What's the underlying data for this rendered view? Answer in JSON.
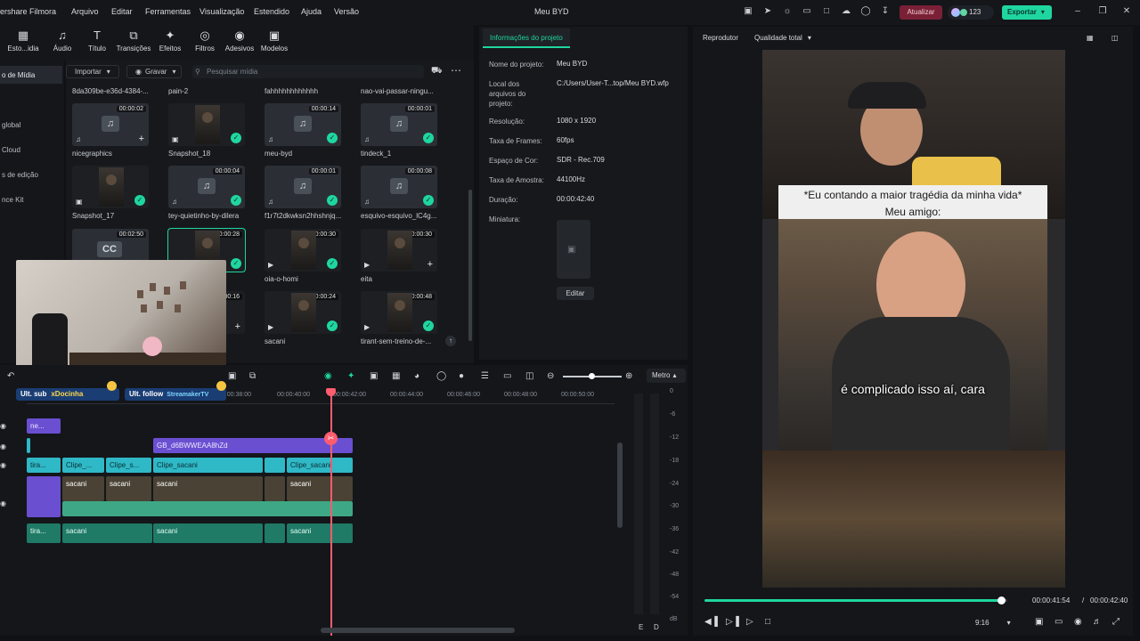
{
  "menubar": {
    "app_name": "ershare Filmora",
    "items": [
      "Arquivo",
      "Editar",
      "Ferramentas",
      "Visualização",
      "Estendido",
      "Ajuda",
      "Versão"
    ],
    "window_title": "Meu BYD",
    "upgrade_label": "Atualizar",
    "credits": "123",
    "export_label": "Exportar"
  },
  "toolbar": {
    "tools": [
      "Esto...idia",
      "Áudio",
      "Título",
      "Transições",
      "Efeitos",
      "Filtros",
      "Adesivos",
      "Modelos"
    ]
  },
  "leftnav": {
    "items": [
      "o de Mídia",
      "global",
      "Cloud",
      "s de edição",
      "nce Kit"
    ]
  },
  "media": {
    "import_label": "Importar",
    "record_label": "Gravar",
    "search_placeholder": "Pesquisar mídia",
    "top_captions": [
      "8da309be-e36d-4384-...",
      "pain-2",
      "fahhhhhhhhhhhh",
      "nao-vai-passar-ningu..."
    ],
    "items": [
      {
        "name": "nicegraphics",
        "duration": "00:00:02",
        "kind": "audio",
        "status": "plus"
      },
      {
        "name": "Snapshot_18",
        "duration": "",
        "kind": "image",
        "status": "check"
      },
      {
        "name": "meu-byd",
        "duration": "00:00:14",
        "kind": "audio",
        "status": "check"
      },
      {
        "name": "tindeck_1",
        "duration": "00:00:01",
        "kind": "audio",
        "status": "check"
      },
      {
        "name": "Snapshot_17",
        "duration": "",
        "kind": "image",
        "status": "check"
      },
      {
        "name": "tey-quietinho-by-dilera",
        "duration": "00:00:04",
        "kind": "audio",
        "status": "check"
      },
      {
        "name": "f1r7t2dkwksn2hhshnjq...",
        "duration": "00:00:01",
        "kind": "audio",
        "status": "check"
      },
      {
        "name": "esquivo-esquivo_lC4g...",
        "duration": "00:00:08",
        "kind": "audio",
        "status": "check"
      },
      {
        "name": "",
        "duration": "00:02:50",
        "kind": "caption",
        "status": ""
      },
      {
        "name": "",
        "duration": "00:00:28",
        "kind": "video",
        "status": "check"
      },
      {
        "name": "oia-o-homi",
        "duration": "00:00:30",
        "kind": "video",
        "status": "check"
      },
      {
        "name": "eita",
        "duration": "00:00:30",
        "kind": "video",
        "status": "plus"
      },
      {
        "name": "",
        "duration": "00:00:16",
        "kind": "video",
        "status": "plus"
      },
      {
        "name": "sacani",
        "duration": "00:00:24",
        "kind": "video",
        "status": "check"
      },
      {
        "name": "tirant-sem-treino-de-...",
        "duration": "00:00:48",
        "kind": "video",
        "status": "check"
      }
    ]
  },
  "props": {
    "tab": "Informações do projeto",
    "rows": [
      {
        "label": "Nome do projeto:",
        "value": "Meu BYD"
      },
      {
        "label": "Local dos arquivos do projeto:",
        "value": "C:/Users/User-T...top/Meu BYD.wfp"
      },
      {
        "label": "Resolução:",
        "value": "1080 x 1920"
      },
      {
        "label": "Taxa de Frames:",
        "value": "60fps"
      },
      {
        "label": "Espaço de Cor:",
        "value": "SDR - Rec.709"
      },
      {
        "label": "Taxa de Amostra:",
        "value": "44100Hz"
      },
      {
        "label": "Duração:",
        "value": "00:00:42:40"
      },
      {
        "label": "Miniatura:",
        "value": ""
      }
    ],
    "edit_label": "Editar"
  },
  "player": {
    "title": "Reprodutor",
    "quality": "Qualidade total",
    "caption_top": "*Eu contando a maior tragédia da minha vida*",
    "caption_mid": "Meu amigo:",
    "caption_sub": "é complicado isso aí, cara",
    "current_time": "00:00:41:54",
    "total_time": "00:00:42:40",
    "progress": 0.98,
    "aspect": "9:16"
  },
  "timeline": {
    "meter_label": "Metro",
    "ruler": [
      "00:00:38:00",
      "00:00:40:00",
      "00:00:42:00",
      "00:00:44:00",
      "00:00:46:00",
      "00:00:48:00",
      "00:00:50:00"
    ],
    "meter_scale": [
      "0",
      "-6",
      "-12",
      "-18",
      "-24",
      "-30",
      "-36",
      "-42",
      "-48",
      "-54",
      "dB"
    ],
    "meter_channels": [
      "E",
      "D"
    ],
    "clips": {
      "t1": "ne...",
      "t2": "GB_d6BWWEAA8hZd",
      "t3a": "tira...",
      "t3b": "Clipe_...",
      "t3c": "Clipe_s...",
      "t3d": "Clipe_sacani",
      "t3e": "Clipe_sacani",
      "v1": "sacani",
      "v2": "sacani",
      "v3": "sacani",
      "v4": "sacani",
      "a0": "tira...",
      "a1": "sacani",
      "a2": "sacani",
      "a3": "sacani",
      "a4": "sacani"
    }
  },
  "stream_overlay": {
    "sub_label": "Ult. sub",
    "sub_name": "xDocinha",
    "follow_label": "Ult. follow",
    "follow_name": "StreamakerTV"
  }
}
